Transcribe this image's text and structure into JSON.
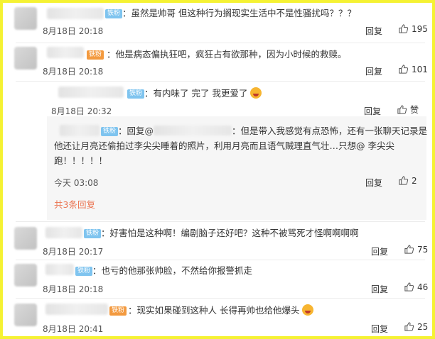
{
  "comments": [
    {
      "fan_badge": "铁粉",
      "text": "：虽然是帅哥 但这种行为搁现实生活中不是性骚扰吗？？？",
      "time": "8月18日 20:18",
      "reply": "回复",
      "likes": "195"
    },
    {
      "fan_badge": "铁粉",
      "text": "：他是病态偏执狂吧，疯狂占有欲那种，因为小时候的救赎。",
      "time": "8月18日 20:18",
      "reply": "回复",
      "likes": "101"
    },
    {
      "fan_badge": "铁粉",
      "text": "：有内味了 完了 我更爱了",
      "time": "8月18日 20:32",
      "reply": "回复",
      "likes": "赞"
    },
    {
      "fan_badge": "铁粉",
      "text": "：好害怕是这种啊！编剧脑子还好吧？这种不被骂死才怪啊啊啊啊",
      "time": "8月18日 20:17",
      "reply": "回复",
      "likes": "75"
    },
    {
      "fan_badge": "铁粉",
      "text": "：也亏的他那张帅脸，不然给你报警抓走",
      "time": "8月18日 20:18",
      "reply": "回复",
      "likes": "46"
    },
    {
      "fan_badge": "铁粉",
      "text": "：现实如果碰到这种人 长得再帅也给他爆头",
      "time": "8月18日 20:41",
      "reply": "回复",
      "likes": "25"
    }
  ],
  "sub_reply": {
    "fan_badge": "铁粉",
    "line1_prefix": "：回复@",
    "line1_rest": "：但是带入我感觉有点恐怖，还有一张聊天记录是",
    "line2": "他还让月亮还偷拍过李尖尖睡着的照片，利用月亮而且语气贼理直气壮…只想@ 李尖尖",
    "line3": "跑！！！！！",
    "time": "今天 03:08",
    "reply": "回复",
    "likes": "2"
  },
  "more_replies": "共3条回复",
  "colors": {
    "border": "#f5f233",
    "fan_badge": "#7fc4ef",
    "link": "#eb7350"
  }
}
